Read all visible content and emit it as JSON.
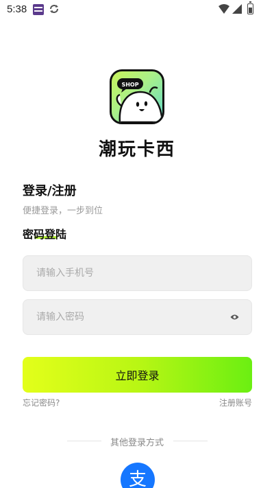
{
  "status_bar": {
    "time": "5:38"
  },
  "app": {
    "title": "潮玩卡西",
    "logo_text": "SHOP"
  },
  "login": {
    "title": "登录/注册",
    "subtitle": "便捷登录，一步到位",
    "method_label": "密码登陆",
    "phone_placeholder": "请输入手机号",
    "password_placeholder": "请输入密码",
    "submit_label": "立即登录",
    "forgot_label": "忘记密码?",
    "register_label": "注册账号"
  },
  "other_login": {
    "label": "其他登录方式",
    "alipay_glyph": "支"
  },
  "colors": {
    "accent_start": "#e3ff1a",
    "accent_end": "#6bef12",
    "alipay_blue": "#1677ff"
  },
  "icons": [
    "notification-icon",
    "sync-icon",
    "wifi-icon",
    "signal-icon",
    "battery-icon",
    "eye-icon",
    "alipay-icon"
  ]
}
